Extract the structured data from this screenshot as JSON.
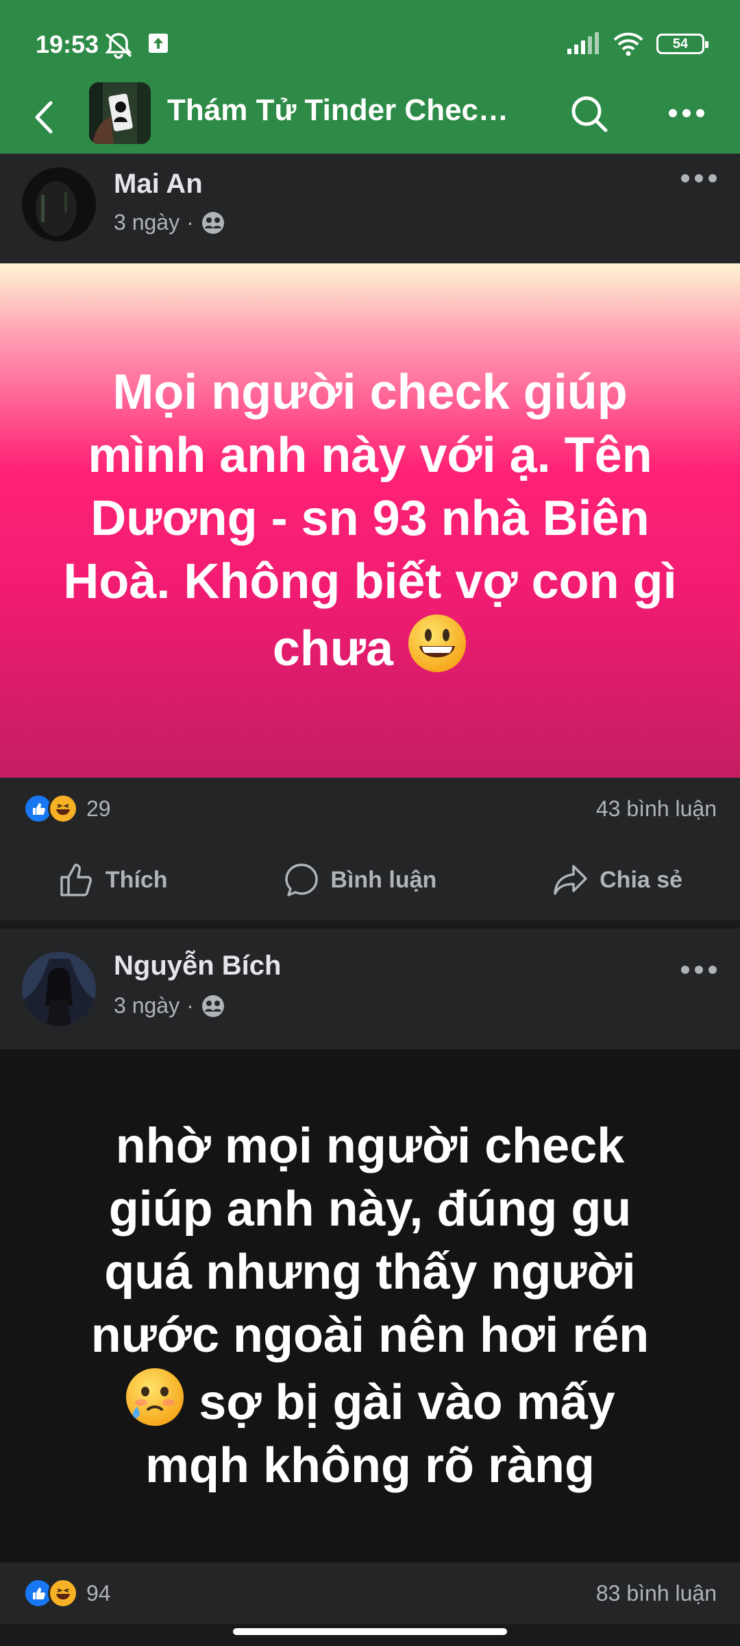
{
  "status_bar": {
    "time": "19:53",
    "battery": "54"
  },
  "header": {
    "back_icon": "back-arrow-icon",
    "title": "Thám Tử Tinder Check Sao Kê",
    "search_icon": "search-icon",
    "more_icon": "more-icon"
  },
  "posts": [
    {
      "author": "Mai An",
      "time": "3 ngày",
      "privacy_icon": "group-icon",
      "text": "Mọi người check giúp mình anh này với ạ. Tên Dương - sn 93 nhà Biên Hoà. Không biết vợ con gì chưa",
      "emoji": "grinning-face",
      "background": [
        "#fff3cf",
        "#ff1e7a",
        "#c21a63"
      ],
      "reaction_count": "29",
      "comment_count": "43 bình luận"
    },
    {
      "author": "Nguyễn Bích",
      "time": "3 ngày",
      "privacy_icon": "group-icon",
      "text_line1": "nhờ mọi người check giúp anh này, đúng gu quá nhưng thấy người nước ngoài nên hơi rén",
      "text_line2": "sợ bị gài vào mấy mqh không rõ ràng",
      "emoji": "face-holding-back-tears",
      "background": [
        "#141414"
      ],
      "reaction_count": "94",
      "comment_count": "83 bình luận"
    }
  ],
  "actions": {
    "like": "Thích",
    "comment": "Bình luận",
    "share": "Chia sẻ"
  },
  "colors": {
    "header_green": "#2e8b47",
    "card_bg": "#242526",
    "page_bg": "#18191a",
    "like_blue": "#1877f2",
    "haha_yellow": "#f7b125"
  }
}
